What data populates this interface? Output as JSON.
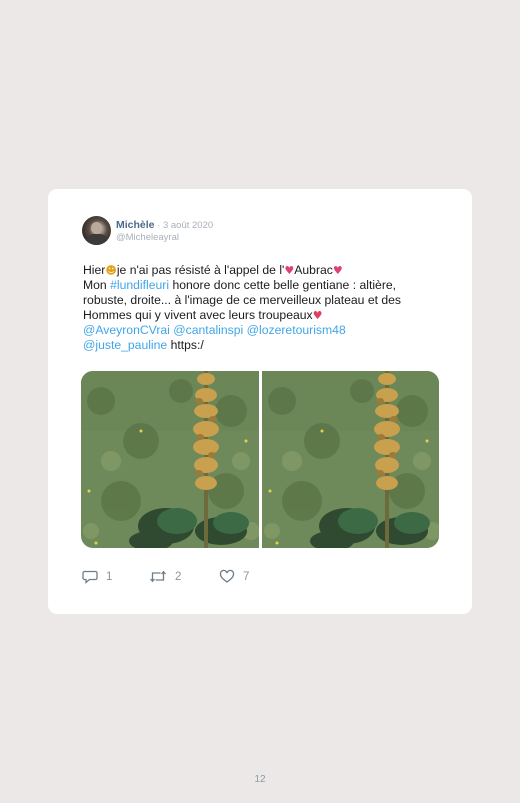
{
  "tweet": {
    "author_name": "Michèle",
    "date": " · 3 août 2020",
    "handle": "@Micheleayral",
    "text": {
      "l1_a": "Hier",
      "l1_b": "je n'ai pas résisté à l'appel de l'",
      "l1_c": "Aubrac",
      "l2_a": "Mon ",
      "l2_hashtag": "#lundifleuri",
      "l2_b": " honore donc cette belle gentiane : altière, robuste, droite... à l'image de ce merveilleux plateau et des Hommes qui y vivent avec leurs troupeaux",
      "mention1": "@AveyronCVrai",
      "mention2": "@cantalinspi",
      "mention3": "@lozeretourism48",
      "mention4": "@juste_pauline",
      "url": "https:/"
    },
    "emoji": {
      "smile": "☻",
      "heart": "♥"
    },
    "images": [
      "gentian-photo-left",
      "gentian-photo-right"
    ],
    "counts": {
      "replies": "1",
      "retweets": "2",
      "likes": "7"
    }
  },
  "page": {
    "number": "12"
  },
  "icons": [
    "reply-icon",
    "retweet-icon",
    "like-icon"
  ]
}
